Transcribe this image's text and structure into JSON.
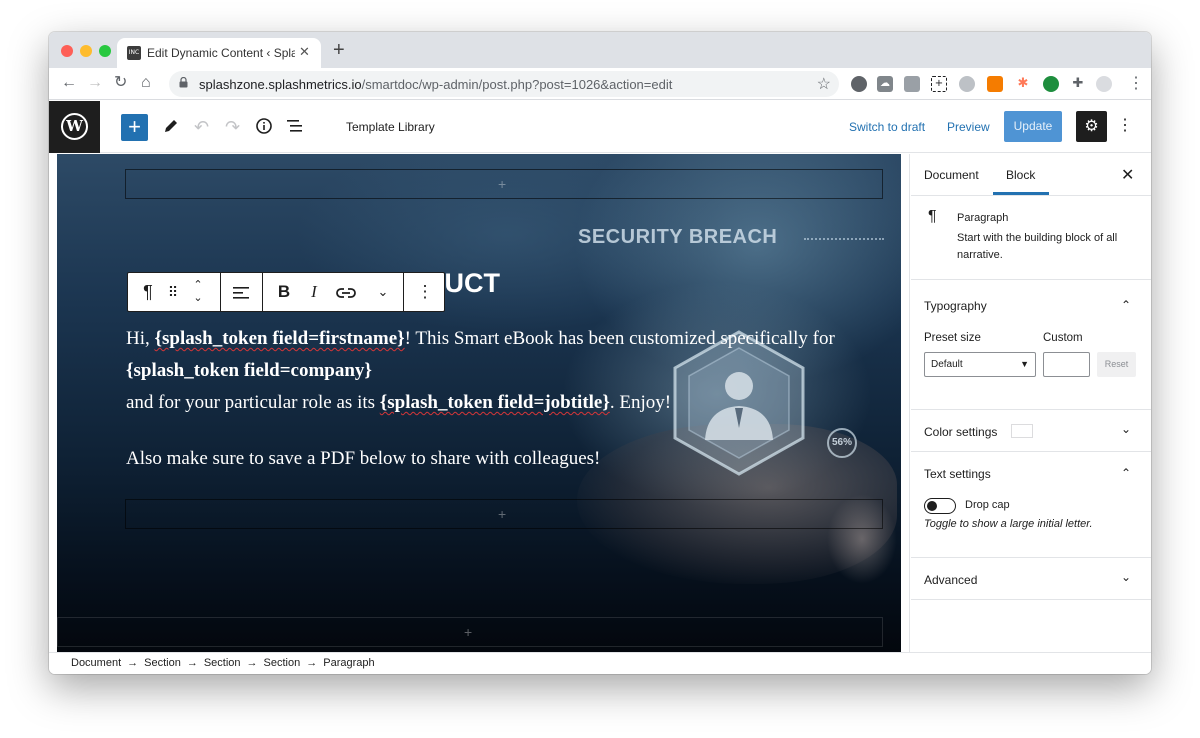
{
  "browser": {
    "tab_title": "Edit Dynamic Content ‹ Splash",
    "tab_favicon_text": "INC",
    "url_host": "splashzone.splashmetrics.io",
    "url_path": "/smartdoc/wp-admin/post.php?post=1026&action=edit"
  },
  "header": {
    "template_library": "Template Library",
    "switch_to_draft": "Switch to draft",
    "preview": "Preview",
    "update": "Update"
  },
  "canvas": {
    "background_text": "SECURITY BREACH",
    "badge_text": "56%",
    "heading_visible": "DUCT",
    "line1_prefix": "Hi, ",
    "token_firstname": "{splash_token field=firstname}",
    "line1_suffix": "! This Smart eBook has been customized specifically for",
    "token_company": "{splash_token field=company}",
    "line3_prefix": "and for your particular role as its ",
    "token_jobtitle": "{splash_token field=jobtitle}",
    "line3_suffix": ". Enjoy!",
    "line4": "Also make sure to save a PDF below to share with colleagues!"
  },
  "sidebar": {
    "tabs": [
      {
        "label": "Document",
        "active": false
      },
      {
        "label": "Block",
        "active": true
      }
    ],
    "block_card": {
      "title": "Paragraph",
      "description": "Start with the building block of all narrative."
    },
    "typography": {
      "title": "Typography",
      "preset_label": "Preset size",
      "custom_label": "Custom",
      "preset_value": "Default",
      "reset_label": "Reset"
    },
    "color_settings": {
      "title": "Color settings"
    },
    "text_settings": {
      "title": "Text settings",
      "drop_cap_label": "Drop cap",
      "drop_cap_help": "Toggle to show a large initial letter."
    },
    "advanced": {
      "title": "Advanced"
    }
  },
  "breadcrumb": [
    "Document",
    "Section",
    "Section",
    "Section",
    "Paragraph"
  ],
  "colors": {
    "accent": "#2271b1",
    "update_button": "#4f94d4",
    "wp_dark": "#1e1e1e"
  }
}
